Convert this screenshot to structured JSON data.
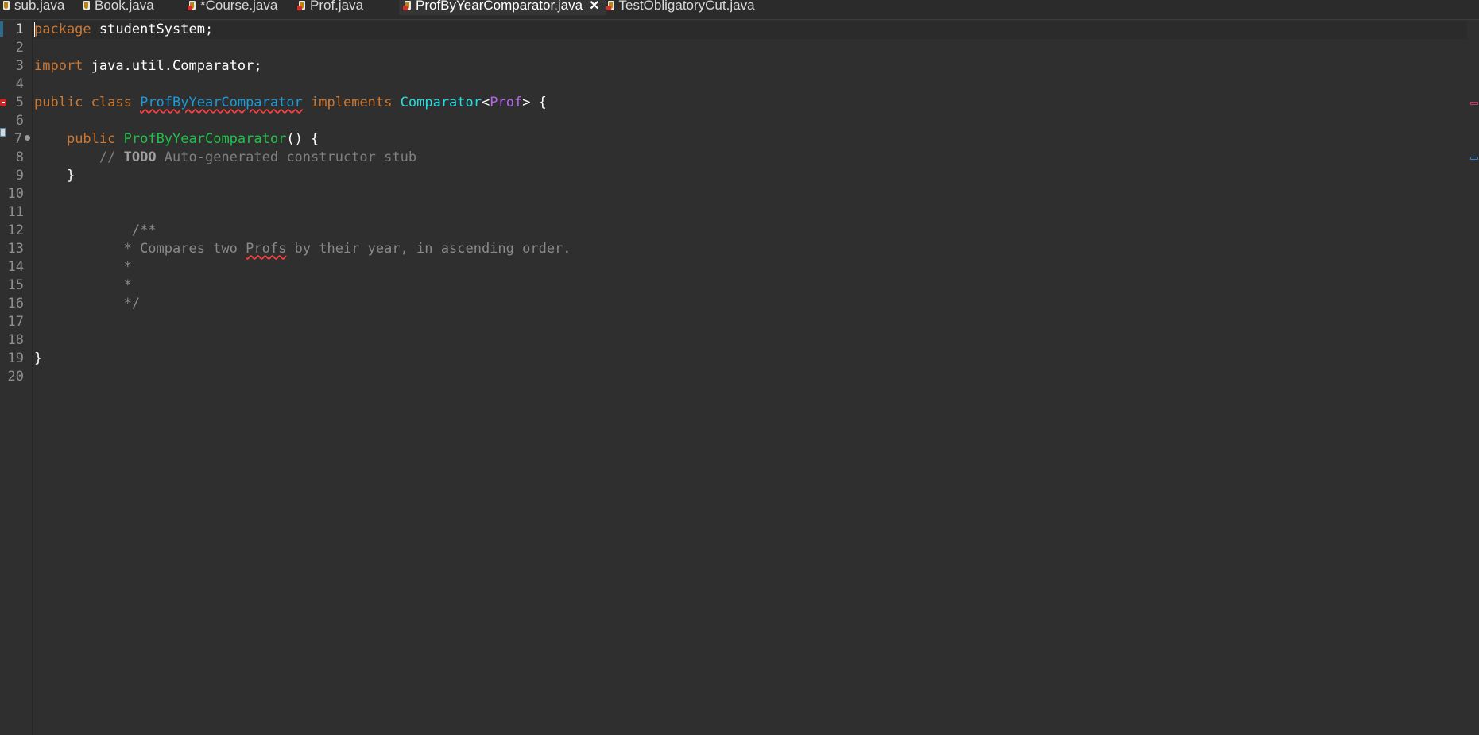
{
  "tabs": [
    {
      "label": "sub.java",
      "icon": "java-file-icon",
      "error": false,
      "active": false
    },
    {
      "label": "Book.java",
      "icon": "java-file-icon",
      "error": false,
      "active": false
    },
    {
      "label": "*Course.java",
      "icon": "java-file-error-icon",
      "error": true,
      "active": false
    },
    {
      "label": "Prof.java",
      "icon": "java-file-error-icon",
      "error": true,
      "active": false
    },
    {
      "label": "ProfByYearComparator.java",
      "icon": "java-file-error-icon",
      "error": true,
      "active": true,
      "close": "✕"
    },
    {
      "label": "TestObligatoryCut.java",
      "icon": "java-file-error-icon",
      "error": true,
      "active": false
    }
  ],
  "editor": {
    "line_numbers": [
      "1",
      "2",
      "3",
      "4",
      "5",
      "6",
      "7",
      "8",
      "9",
      "10",
      "11",
      "12",
      "13",
      "14",
      "15",
      "16",
      "17",
      "18",
      "19",
      "20"
    ],
    "code": {
      "l1_kw": "package",
      "l1_rest": " studentSystem;",
      "l3_kw": "import",
      "l3_rest": " java.util.Comparator;",
      "l5_kw": "public class",
      "l5_class": "ProfByYearComparator",
      "l5_impl": "implements",
      "l5_iface": "Comparator",
      "l5_lt": "<",
      "l5_generic": "Prof",
      "l5_gt": "> {",
      "l7_kw": "public",
      "l7_ctor": "ProfByYearComparator",
      "l7_rest": "() {",
      "l8_slashes": "// ",
      "l8_todo": "TODO",
      "l8_text": " Auto-generated constructor stub",
      "l9": "}",
      "l12": "/**",
      "l13_a": "* Compares two ",
      "l13_word": "Profs",
      "l13_b": " by their year, in ascending order.",
      "l14": "*",
      "l15": "*",
      "l16": "*/",
      "l19": "}"
    }
  },
  "colors": {
    "background": "#2f2f2f",
    "keyword": "#cc7832",
    "class_name": "#1e9ad6",
    "interface": "#1ee0e0",
    "generic": "#b565e8",
    "constructor": "#24c04a",
    "comment": "#808080",
    "error": "#c62828"
  }
}
